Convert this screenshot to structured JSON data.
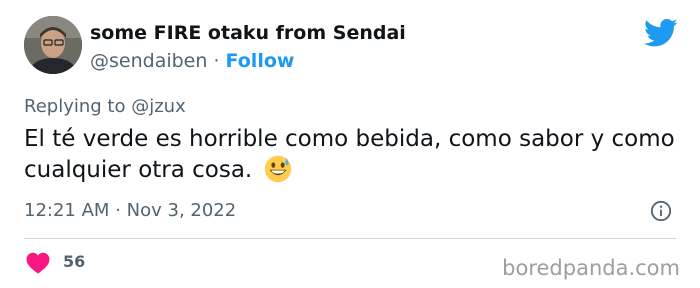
{
  "author": {
    "display_name": "some FIRE otaku from Sendai",
    "handle": "@sendaiben",
    "separator": "·",
    "follow_label": "Follow"
  },
  "reply": {
    "prefix": "Replying to",
    "target": "@jzux"
  },
  "tweet": {
    "text": "El té verde es horrible como bebida, como sabor y como cualquier otra cosa.",
    "emoji": "grinning-face-with-sweat"
  },
  "timestamp": {
    "time": "12:21 AM",
    "separator": "·",
    "date": "Nov 3, 2022"
  },
  "engagement": {
    "likes": "56"
  },
  "watermark": "boredpanda.com",
  "icons": {
    "logo": "twitter-bird-icon",
    "info": "info-icon",
    "like": "heart-icon"
  },
  "colors": {
    "twitter_blue": "#1d9bf0",
    "heart": "#f91880",
    "secondary_text": "#536471",
    "primary_text": "#0f1419"
  }
}
